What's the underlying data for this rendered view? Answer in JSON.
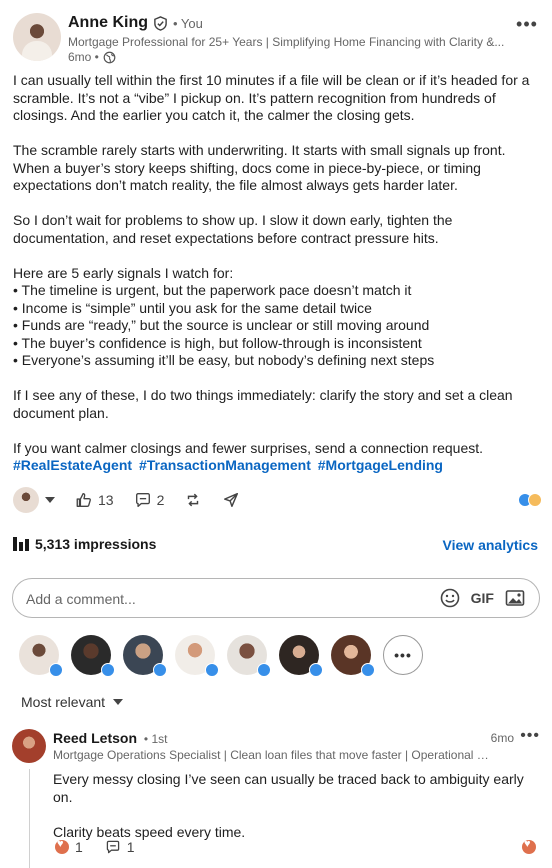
{
  "post": {
    "author": {
      "name": "Anne King",
      "degree": "• You",
      "headline": "Mortgage Professional for 25+ Years | Simplifying Home Financing with Clarity &...",
      "time": "6mo •"
    },
    "paragraphs": [
      "I can usually tell within the first 10 minutes if a file will be clean or if it’s headed for a scramble. It’s not a “vibe” I pickup on. It’s pattern recognition from hundreds of closings. And the earlier you catch it, the calmer the closing gets.",
      "The scramble rarely starts with underwriting. It starts with small signals up front. When a buyer’s story keeps shifting, docs come in piece-by-piece, or timing expectations don’t match reality, the file almost always gets harder later.",
      "So I don’t wait for problems to show up. I slow it down early, tighten the documentation, and reset expectations before contract pressure hits."
    ],
    "list_intro": "Here are 5 early signals I watch for:",
    "bullets": [
      "• The timeline is urgent, but the paperwork pace doesn’t match it",
      "• Income is “simple” until you ask for the same detail twice",
      "• Funds are “ready,” but the source is unclear or still moving around",
      "• The buyer’s confidence is high, but follow-through is inconsistent",
      "• Everyone’s assuming it’ll be easy, but nobody’s defining next steps"
    ],
    "closing_1": "If I see any of these, I do two things immediately: clarify the story and set a clean document plan.",
    "closing_2": "If you want calmer closings and fewer surprises, send a connection request.",
    "hashtags": [
      "#RealEstateAgent",
      "#TransactionManagement",
      "#MortgageLending"
    ]
  },
  "social": {
    "likes": "13",
    "comments": "2"
  },
  "analytics": {
    "impressions": "5,313 impressions",
    "view_label": "View analytics"
  },
  "comment_box": {
    "placeholder": "Add a comment...",
    "gif_label": "GIF"
  },
  "sort": {
    "label": "Most relevant"
  },
  "comment": {
    "name": "Reed Letson",
    "degree": "• 1st",
    "time": "6mo",
    "headline": "Mortgage Operations Specialist | Clean loan files that move faster | Operational e...",
    "text_1": "Every messy closing I’ve seen can usually be traced back to ambiguity early on.",
    "text_2": "Clarity beats speed every time.",
    "reactions": "1",
    "replies": "1"
  },
  "colors": {
    "link": "#0a66c2",
    "like": "#378fe9",
    "love": "#df704d"
  }
}
